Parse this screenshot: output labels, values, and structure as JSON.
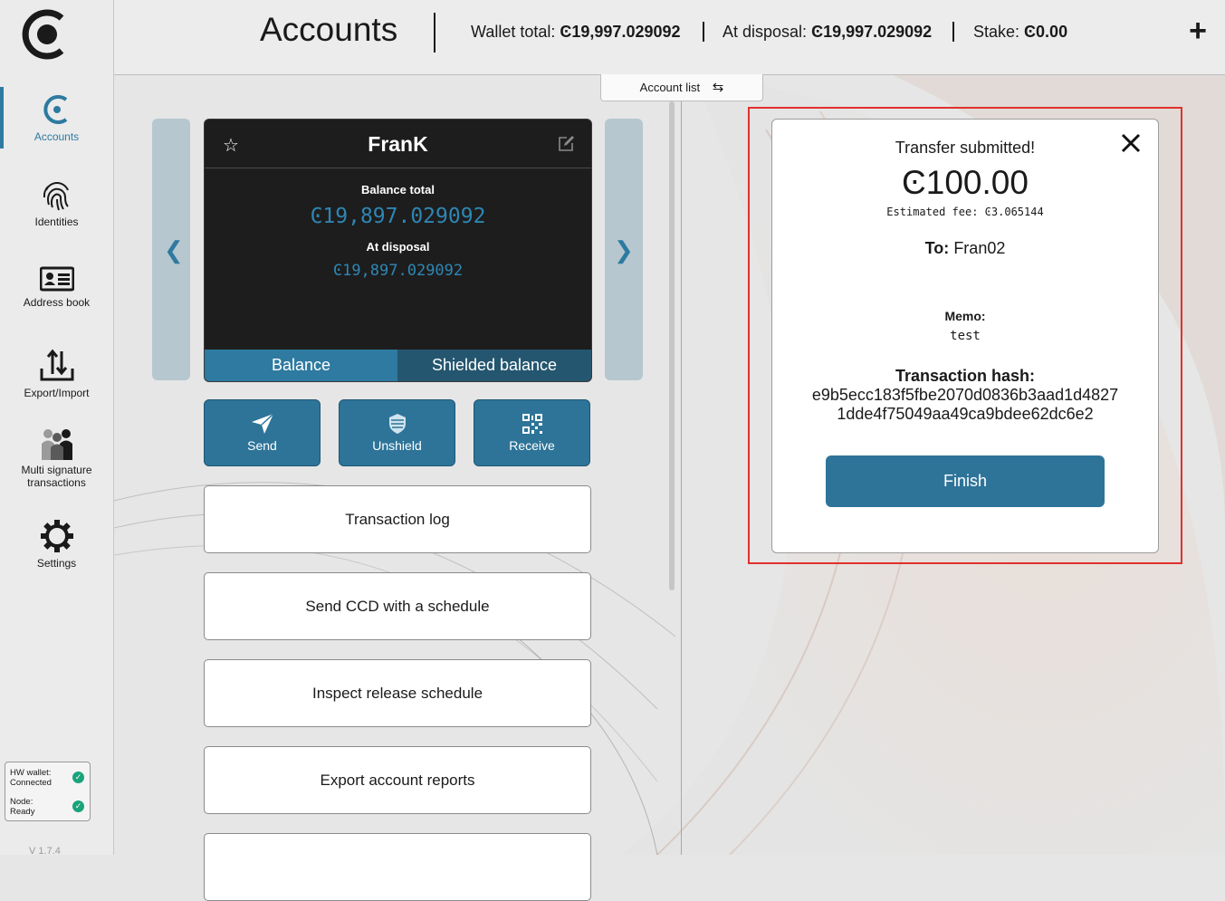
{
  "sidebar": {
    "items": [
      {
        "label": "Accounts",
        "icon": "concordium-accounts-icon",
        "active": true
      },
      {
        "label": "Identities",
        "icon": "fingerprint-icon"
      },
      {
        "label": "Address book",
        "icon": "address-card-icon"
      },
      {
        "label": "Export/Import",
        "icon": "export-import-icon"
      },
      {
        "label": "Multi signature transactions",
        "icon": "multi-user-icon"
      },
      {
        "label": "Settings",
        "icon": "gear-icon"
      }
    ],
    "status": {
      "hw_label": "HW wallet:",
      "hw_value": "Connected",
      "node_label": "Node:",
      "node_value": "Ready",
      "ok_color": "#1aa37a"
    },
    "version": "V 1.7.4"
  },
  "header": {
    "title": "Accounts",
    "wallet_total_label": "Wallet total:",
    "wallet_total_value": "Ͼ19,997.029092",
    "at_disposal_label": "At disposal:",
    "at_disposal_value": "Ͼ19,997.029092",
    "stake_label": "Stake:",
    "stake_value": "Ͼ0.00",
    "add_label": "+"
  },
  "account_list_tab": {
    "label": "Account list",
    "icon": "swap-arrows-icon"
  },
  "account_card": {
    "name": "FranK",
    "balance_total_label": "Balance total",
    "balance_total_value": "Ͼ19,897.029092",
    "at_disposal_label": "At disposal",
    "at_disposal_value": "Ͼ19,897.029092",
    "tabs": [
      "Balance",
      "Shielded balance"
    ],
    "accent": "#2e86b4"
  },
  "actions": [
    {
      "label": "Send",
      "icon": "send-icon"
    },
    {
      "label": "Unshield",
      "icon": "unshield-icon"
    },
    {
      "label": "Receive",
      "icon": "qr-code-icon"
    }
  ],
  "menu": [
    "Transaction log",
    "Send CCD with a schedule",
    "Inspect release schedule",
    "Export account reports"
  ],
  "modal": {
    "title": "Transfer submitted!",
    "amount": "Ͼ100.00",
    "fee": "Estimated fee: Ͼ3.065144",
    "to_label": "To:",
    "to_value": "Fran02",
    "memo_label": "Memo:",
    "memo_value": "test",
    "hash_label": "Transaction hash:",
    "hash_line1": "e9b5ecc183f5fbe2070d0836b3aad1d4827",
    "hash_line2": "1dde4f75049aa49ca9bdee62dc6e2",
    "finish_label": "Finish",
    "highlight_color": "#e0312c"
  }
}
